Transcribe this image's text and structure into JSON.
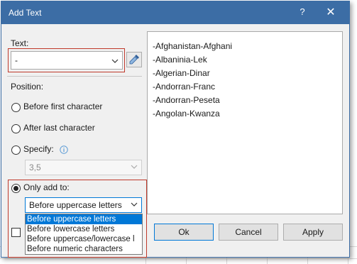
{
  "dialog": {
    "title": "Add Text",
    "help_label": "?",
    "close_label": "✕"
  },
  "text_section": {
    "label": "Text:",
    "value": "-"
  },
  "position_section": {
    "label": "Position:",
    "before_first": "Before first character",
    "after_last": "After last character",
    "specify": "Specify:",
    "specify_value": "3,5",
    "only_add_to": "Only add to:",
    "only_add_to_selected": "Before uppercase letters",
    "options": [
      "Before uppercase letters",
      "Before lowercase letters",
      "Before uppercase/lowercase l",
      "Before numeric characters"
    ]
  },
  "preview": {
    "items": [
      "-Afghanistan-Afghani",
      "-Albaninia-Lek",
      "-Algerian-Dinar",
      "-Andorran-Franc",
      "-Andorran-Peseta",
      "-Angolan-Kwanza"
    ]
  },
  "buttons": {
    "ok": "Ok",
    "cancel": "Cancel",
    "apply": "Apply"
  },
  "colors": {
    "titlebar": "#3c6da5",
    "highlight": "#0078d7",
    "annotation": "#c0392b"
  }
}
